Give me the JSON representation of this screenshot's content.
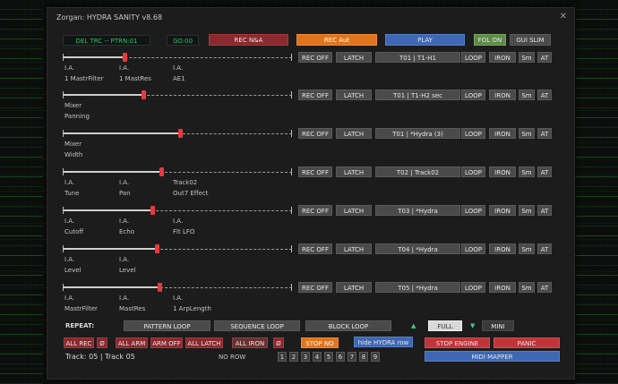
{
  "window": {
    "title": "Zorgan: HYDRA SANITY v8.68",
    "close": "✕"
  },
  "top": {
    "lcd_left": "DEL TRC -- PTRN:01",
    "lcd_right": "GO:00",
    "rec_na": "REC N&A",
    "rec_aut": "REC Aut",
    "play": "PLAY",
    "fol_on": "FOL ON",
    "gui_slim": "GUI SLIM"
  },
  "rows": [
    {
      "rec": "REC OFF",
      "latch": "LATCH",
      "track": "T01 | T1-H1",
      "loop": "LOOP",
      "iron": "IRON",
      "sm": "Sm",
      "at": "AT",
      "level": 0.27,
      "labels": [
        [
          "I.A.",
          "I.A.",
          "I.A."
        ],
        [
          "1 MastrFilter",
          "1 MastRes",
          "AE1"
        ]
      ]
    },
    {
      "rec": "REC OFF",
      "latch": "LATCH",
      "track": "T01 | T1-H2 sec",
      "loop": "LOOP",
      "iron": "IRON",
      "sm": "Sm",
      "at": "AT",
      "level": 0.35,
      "labels": [
        [
          "Mixer"
        ],
        [
          "Panning"
        ]
      ]
    },
    {
      "rec": "REC OFF",
      "latch": "LATCH",
      "track": "T01 | *Hydra (3)",
      "loop": "LOOP",
      "iron": "IRON",
      "sm": "Sm",
      "at": "AT",
      "level": 0.51,
      "labels": [
        [
          "Mixer"
        ],
        [
          "Width"
        ]
      ]
    },
    {
      "rec": "REC OFF",
      "latch": "LATCH",
      "track": "T02 | Track02",
      "loop": "LOOP",
      "iron": "IRON",
      "sm": "Sm",
      "at": "AT",
      "level": 0.43,
      "labels": [
        [
          "I.A.",
          "I.A.",
          "Track02"
        ],
        [
          "Tune",
          "Pan",
          "Out7 Effect"
        ]
      ]
    },
    {
      "rec": "REC OFF",
      "latch": "LATCH",
      "track": "T03 | *Hydra",
      "loop": "LOOP",
      "iron": "IRON",
      "sm": "Sm",
      "at": "AT",
      "level": 0.39,
      "labels": [
        [
          "I.A.",
          "I.A.",
          "I.A."
        ],
        [
          "Cutoff",
          "Echo",
          "Flt LFO"
        ]
      ]
    },
    {
      "rec": "REC OFF",
      "latch": "LATCH",
      "track": "T04 | *Hydra",
      "loop": "LOOP",
      "iron": "IRON",
      "sm": "Sm",
      "at": "AT",
      "level": 0.41,
      "labels": [
        [
          "I.A.",
          "I.A."
        ],
        [
          "Level",
          "Level"
        ]
      ]
    },
    {
      "rec": "REC OFF",
      "latch": "LATCH",
      "track": "T05 | *Hydra",
      "loop": "LOOP",
      "iron": "IRON",
      "sm": "Sm",
      "at": "AT",
      "level": 0.42,
      "labels": [
        [
          "I.A.",
          "I.A.",
          "I.A."
        ],
        [
          "MastrFilter",
          "MastRes",
          "1 ArpLength"
        ]
      ]
    }
  ],
  "repeat": {
    "label": "REPEAT:",
    "pattern_loop": "PATTERN LOOP",
    "sequence_loop": "SEQUENCE LOOP",
    "block_loop": "BLOCK LOOP",
    "up_arrow": "▲",
    "full": "FULL",
    "down_arrow": "▼",
    "mini": "MINI"
  },
  "bottom": {
    "all_rec": "ALL REC",
    "clear1": "Ø",
    "all_arm": "ALL ARM",
    "arm_off": "ARM OFF",
    "all_latch": "ALL LATCH",
    "all_iron": "ALL IRON",
    "clear2": "Ø",
    "stop_no": "STOP NO",
    "hide_hydra": "hide HYDRA row",
    "stop_engine": "STOP ENGINE",
    "panic": "PANIC",
    "midi_mapper": "MIDI MAPPER",
    "track_status": "Track: 05 | Track 05",
    "row_status": "NO ROW",
    "numbers": [
      "1",
      "2",
      "3",
      "4",
      "5",
      "6",
      "7",
      "8",
      "9"
    ]
  },
  "colors": {
    "red_btn": "#c0343a",
    "orange_btn": "#e0741c",
    "blue_btn": "#3e68b4",
    "green_btn": "#5f8a4a",
    "handle": "#e8383d",
    "lcd_text": "#36c26b"
  }
}
